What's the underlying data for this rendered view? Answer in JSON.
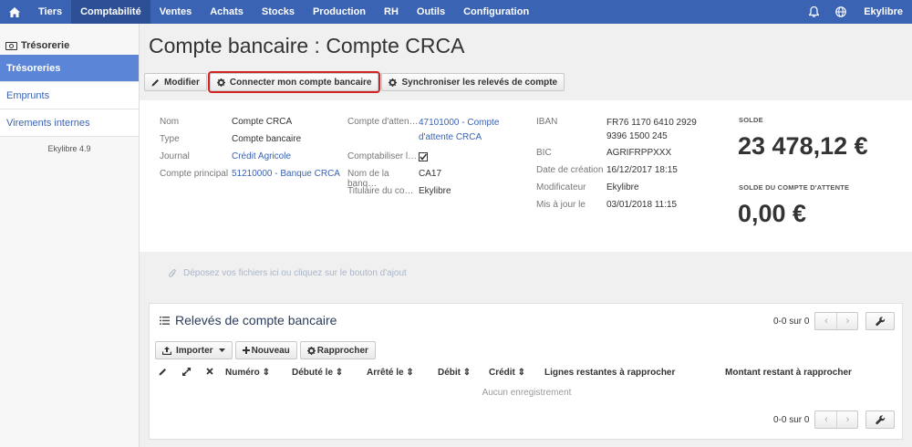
{
  "nav": {
    "items": [
      "Tiers",
      "Comptabilité",
      "Ventes",
      "Achats",
      "Stocks",
      "Production",
      "RH",
      "Outils",
      "Configuration"
    ],
    "active": "Comptabilité",
    "user": "Ekylibre"
  },
  "sidebar": {
    "section": "Trésorerie",
    "items": [
      "Trésoreries",
      "Emprunts",
      "Virements internes"
    ],
    "version": "Ekylibre 4.9"
  },
  "page": {
    "title": "Compte bancaire : Compte CRCA"
  },
  "toolbar": {
    "modify": "Modifier",
    "connect": "Connecter mon compte bancaire",
    "sync": "Synchroniser les relevés de compte"
  },
  "details": {
    "col1": [
      {
        "label": "Nom",
        "value": "Compte CRCA"
      },
      {
        "label": "Type",
        "value": "Compte bancaire"
      },
      {
        "label": "Journal",
        "value": "Crédit Agricole"
      },
      {
        "label": "Compte principal",
        "value": "51210000 - Banque CRCA"
      }
    ],
    "col2": [
      {
        "label": "Compte d'atten…",
        "value": "47101000 - Compte d'attente CRCA"
      },
      {
        "label": "Comptabiliser l…",
        "value": ""
      },
      {
        "label": "Nom de la banq…",
        "value": "CA17"
      },
      {
        "label": "Titulaire du co…",
        "value": "Ekylibre"
      }
    ],
    "col3": [
      {
        "label": "IBAN",
        "value": "FR76 1170 6410 2929 9396 1500 245"
      },
      {
        "label": "BIC",
        "value": "AGRIFRPPXXX"
      },
      {
        "label": "Date de création",
        "value": "16/12/2017 18:15"
      },
      {
        "label": "Modificateur",
        "value": "Ekylibre"
      },
      {
        "label": "Mis à jour le",
        "value": "03/01/2018 11:15"
      }
    ],
    "solde_label": "SOLDE",
    "solde_value": "23 478,12 €",
    "attente_label": "SOLDE DU COMPTE D'ATTENTE",
    "attente_value": "0,00 €"
  },
  "dropzone": {
    "text": "Déposez vos fichiers ici ou cliquez sur le bouton d'ajout"
  },
  "statements": {
    "title": "Relevés de compte bancaire",
    "pager": "0-0 sur 0",
    "import": "Importer",
    "new": "Nouveau",
    "reconcile": "Rapprocher",
    "columns": [
      "Numéro",
      "Débuté le",
      "Arrêté le",
      "Débit",
      "Crédit",
      "Lignes restantes à rapprocher",
      "Montant restant à rapprocher"
    ],
    "empty": "Aucun enregistrement"
  },
  "colors": {
    "nav": "#3b63b3",
    "nav_active": "#2d4f95",
    "sidebar_active": "#5b85d6",
    "highlight": "#d32424"
  }
}
